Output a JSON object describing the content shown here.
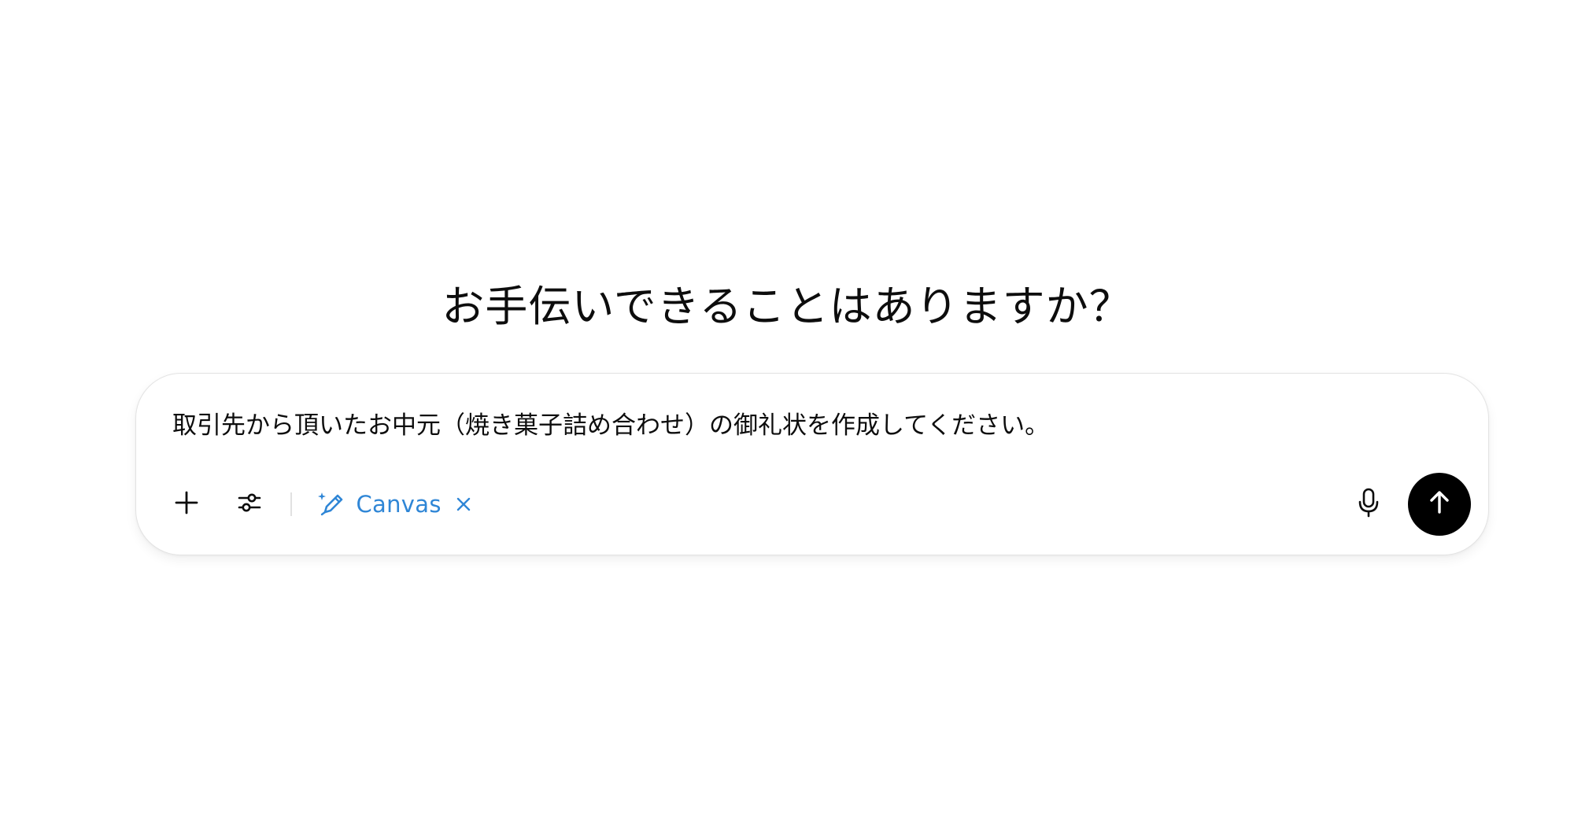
{
  "main": {
    "heading": "お手伝いできることはありますか？"
  },
  "composer": {
    "input_value": "取引先から頂いたお中元（焼き菓子詰め合わせ）の御礼状を作成してください。",
    "tools": {
      "add_icon": "plus-icon",
      "tools_icon": "sliders-icon",
      "canvas_label": "Canvas",
      "canvas_icon": "pencil-sparkle-icon",
      "canvas_close_icon": "close-icon",
      "mic_icon": "microphone-icon",
      "send_icon": "arrow-up-icon"
    },
    "colors": {
      "canvas_accent": "#2f86d6",
      "send_bg": "#000000",
      "border": "#e3e3e3"
    }
  }
}
